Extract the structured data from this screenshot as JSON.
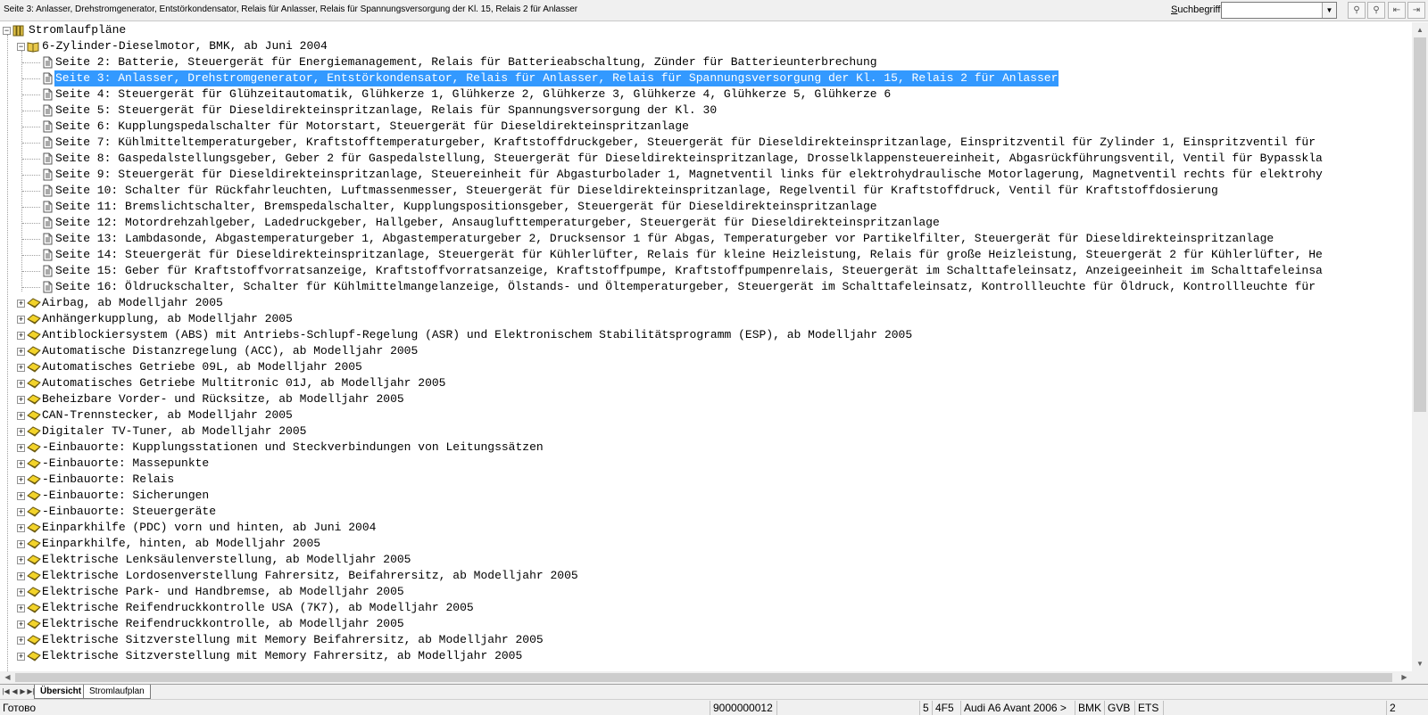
{
  "topbar": {
    "title": "Seite 3: Anlasser, Drehstromgenerator, Entstörkondensator, Relais für Anlasser, Relais für Spannungsversorgung der Kl. 15, Relais 2 für Anlasser",
    "search_label_prefix": "S",
    "search_label_rest": "uchbegriff:",
    "search_value": ""
  },
  "tree": {
    "root": {
      "label": "Stromlaufpläne",
      "icon": "books-icon"
    },
    "engine": {
      "label": "6-Zylinder-Dieselmotor, BMK, ab Juni 2004",
      "icon": "open-book-icon"
    },
    "pages": [
      "Seite 2: Batterie, Steuergerät für Energiemanagement, Relais für Batterieabschaltung, Zünder für Batterieunterbrechung",
      "Seite 3: Anlasser, Drehstromgenerator, Entstörkondensator, Relais für Anlasser, Relais für Spannungsversorgung der Kl. 15, Relais 2 für Anlasser",
      "Seite 4: Steuergerät für Glühzeitautomatik, Glühkerze 1, Glühkerze 2, Glühkerze 3, Glühkerze 4, Glühkerze 5, Glühkerze 6",
      "Seite 5: Steuergerät für Dieseldirekteinspritzanlage, Relais für Spannungsversorgung der Kl. 30",
      "Seite 6: Kupplungspedalschalter für Motorstart, Steuergerät für Dieseldirekteinspritzanlage",
      "Seite 7: Kühlmitteltemperaturgeber, Kraftstofftemperaturgeber, Kraftstoffdruckgeber, Steuergerät für Dieseldirekteinspritzanlage, Einspritzventil für Zylinder 1, Einspritzventil für",
      "Seite 8: Gaspedalstellungsgeber, Geber 2 für Gaspedalstellung, Steuergerät für Dieseldirekteinspritzanlage, Drosselklappensteuereinheit, Abgasrückführungsventil, Ventil für Bypasskla",
      "Seite 9: Steuergerät für Dieseldirekteinspritzanlage, Steuereinheit für Abgasturbolader 1, Magnetventil links für elektrohydraulische Motorlagerung, Magnetventil rechts für elektrohy",
      "Seite 10: Schalter für Rückfahrleuchten, Luftmassenmesser, Steuergerät für Dieseldirekteinspritzanlage, Regelventil für Kraftstoffdruck, Ventil für Kraftstoffdosierung",
      "Seite 11: Bremslichtschalter, Bremspedalschalter, Kupplungspositionsgeber, Steuergerät für Dieseldirekteinspritzanlage",
      "Seite 12: Motordrehzahlgeber, Ladedruckgeber, Hallgeber, Ansauglufttemperaturgeber, Steuergerät für Dieseldirekteinspritzanlage",
      "Seite 13: Lambdasonde, Abgastemperaturgeber 1, Abgastemperaturgeber 2, Drucksensor 1 für Abgas, Temperaturgeber vor Partikelfilter, Steuergerät für Dieseldirekteinspritzanlage",
      "Seite 14: Steuergerät für Dieseldirekteinspritzanlage, Steuergerät für Kühlerlüfter, Relais für kleine Heizleistung, Relais für große Heizleistung, Steuergerät 2 für Kühlerlüfter, He",
      "Seite 15: Geber für Kraftstoffvorratsanzeige, Kraftstoffvorratsanzeige, Kraftstoffpumpe, Kraftstoffpumpenrelais, Steuergerät im Schalttafeleinsatz, Anzeigeeinheit im Schalttafeleinsa",
      "Seite 16: Öldruckschalter, Schalter für Kühlmittelmangelanzeige, Ölstands- und Öltemperaturgeber, Steuergerät im Schalttafeleinsatz, Kontrollleuchte für Öldruck, Kontrollleuchte für"
    ],
    "selected_index": 1,
    "groups": [
      "Airbag, ab Modelljahr 2005",
      "Anhängerkupplung, ab Modelljahr 2005",
      "Antiblockiersystem (ABS) mit Antriebs-Schlupf-Regelung (ASR) und Elektronischem Stabilitätsprogramm (ESP), ab Modelljahr 2005",
      "Automatische Distanzregelung (ACC), ab Modelljahr 2005",
      "Automatisches Getriebe 09L, ab Modelljahr 2005",
      "Automatisches Getriebe Multitronic 01J, ab Modelljahr 2005",
      "Beheizbare Vorder- und Rücksitze, ab Modelljahr 2005",
      "CAN-Trennstecker, ab Modelljahr 2005",
      "Digitaler TV-Tuner, ab Modelljahr 2005",
      "-Einbauorte: Kupplungsstationen und Steckverbindungen von Leitungssätzen",
      "-Einbauorte: Massepunkte",
      "-Einbauorte: Relais",
      "-Einbauorte: Sicherungen",
      "-Einbauorte: Steuergeräte",
      "Einparkhilfe (PDC) vorn und hinten, ab Juni 2004",
      "Einparkhilfe, hinten, ab Modelljahr 2005",
      "Elektrische Lenksäulenverstellung, ab Modelljahr 2005",
      "Elektrische Lordosenverstellung Fahrersitz, Beifahrersitz, ab Modelljahr 2005",
      "Elektrische Park- und Handbremse, ab Modelljahr 2005",
      "Elektrische Reifendruckkontrolle USA (7K7), ab Modelljahr 2005",
      "Elektrische Reifendruckkontrolle, ab Modelljahr 2005",
      "Elektrische Sitzverstellung mit Memory Beifahrersitz, ab Modelljahr 2005",
      "Elektrische Sitzverstellung mit Memory Fahrersitz, ab Modelljahr 2005"
    ]
  },
  "tabs": [
    "Übersicht",
    "Stromlaufplan"
  ],
  "status": {
    "ready": "Готово",
    "number": "9000000012",
    "s1": "5",
    "s2": "4F5",
    "car": "Audi A6 Avant 2006 >",
    "s3": "BMK",
    "s4": "GVB",
    "s5": "ETS",
    "s6": "2"
  },
  "colors": {
    "selection": "#3399ff",
    "folder_yellow": "#f2d32a",
    "book_yellow": "#e8c84a"
  }
}
